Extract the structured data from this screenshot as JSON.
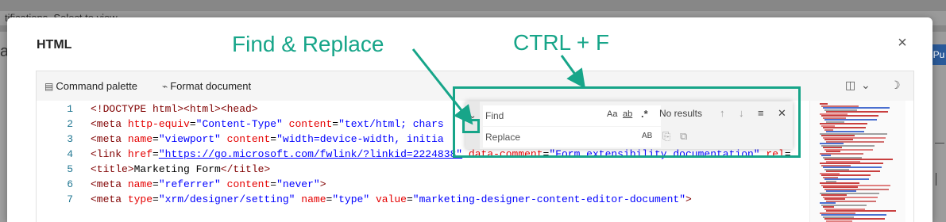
{
  "background": {
    "notification_strip": "tifications. Select to view",
    "left_fragment": "ap",
    "right_chip": "Pu"
  },
  "modal": {
    "title": "HTML",
    "close_icon": "×"
  },
  "toolbar": {
    "command_palette_label": "Command palette",
    "format_document_label": "Format document",
    "command_palette_icon": "▤",
    "format_document_icon": "⌁",
    "split_icon": "◫",
    "chevron_icon": "⌄",
    "theme_icon": "☽"
  },
  "editor": {
    "lines": [
      {
        "n": "1",
        "parts": [
          [
            "t-tag",
            "<!DOCTYPE html><html><head>"
          ]
        ]
      },
      {
        "n": "2",
        "parts": [
          [
            "t-tag",
            "    <meta "
          ],
          [
            "t-attr",
            "http-equiv"
          ],
          [
            "t-txt",
            "="
          ],
          [
            "t-val",
            "\"Content-Type\""
          ],
          [
            "t-txt",
            " "
          ],
          [
            "t-attr",
            "content"
          ],
          [
            "t-txt",
            "="
          ],
          [
            "t-val",
            "\"text/html; chars"
          ]
        ]
      },
      {
        "n": "3",
        "parts": [
          [
            "t-tag",
            "    <meta "
          ],
          [
            "t-attr",
            "name"
          ],
          [
            "t-txt",
            "="
          ],
          [
            "t-val",
            "\"viewport\""
          ],
          [
            "t-txt",
            " "
          ],
          [
            "t-attr",
            "content"
          ],
          [
            "t-txt",
            "="
          ],
          [
            "t-val",
            "\"width=device-width, initia"
          ]
        ]
      },
      {
        "n": "4",
        "parts": [
          [
            "t-tag",
            "    <link "
          ],
          [
            "t-attr",
            "href"
          ],
          [
            "t-txt",
            "="
          ],
          [
            "t-link",
            "\"https://go.microsoft.com/fwlink/?linkid=2224838\""
          ],
          [
            "t-txt",
            " "
          ],
          [
            "t-attr",
            "data-comment"
          ],
          [
            "t-txt",
            "="
          ],
          [
            "t-val",
            "\"Form extensibility documentation\""
          ],
          [
            "t-txt",
            " "
          ],
          [
            "t-attr",
            "rel"
          ],
          [
            "t-txt",
            "="
          ]
        ]
      },
      {
        "n": "5",
        "parts": [
          [
            "t-tag",
            "    <title>"
          ],
          [
            "t-txt",
            "Marketing Form"
          ],
          [
            "t-tag",
            "</title>"
          ]
        ]
      },
      {
        "n": "6",
        "parts": [
          [
            "t-tag",
            "    <meta "
          ],
          [
            "t-attr",
            "name"
          ],
          [
            "t-txt",
            "="
          ],
          [
            "t-val",
            "\"referrer\""
          ],
          [
            "t-txt",
            " "
          ],
          [
            "t-attr",
            "content"
          ],
          [
            "t-txt",
            "="
          ],
          [
            "t-val",
            "\"never\""
          ],
          [
            "t-tag",
            ">"
          ]
        ]
      },
      {
        "n": "7",
        "parts": [
          [
            "t-tag",
            "    <meta "
          ],
          [
            "t-attr",
            "type"
          ],
          [
            "t-txt",
            "="
          ],
          [
            "t-val",
            "\"xrm/designer/setting\""
          ],
          [
            "t-txt",
            " "
          ],
          [
            "t-attr",
            "name"
          ],
          [
            "t-txt",
            "="
          ],
          [
            "t-val",
            "\"type\""
          ],
          [
            "t-txt",
            " "
          ],
          [
            "t-attr",
            "value"
          ],
          [
            "t-txt",
            "="
          ],
          [
            "t-val",
            "\"marketing-designer-content-editor-document\""
          ],
          [
            "t-tag",
            ">"
          ]
        ]
      }
    ]
  },
  "find_widget": {
    "find_placeholder": "Find",
    "replace_placeholder": "Replace",
    "match_case": "Aa",
    "whole_word": "ab",
    "regex": ".*",
    "status": "No results",
    "prev_icon": "↑",
    "next_icon": "↓",
    "selection_icon": "≡",
    "close_icon": "✕",
    "preserve_case": "AB",
    "replace_icon": "⎘",
    "replace_all_icon": "⧉",
    "toggle_icon": "⌄"
  },
  "annotations": {
    "find_replace_label": "Find & Replace",
    "ctrl_f_label": "CTRL + F",
    "color": "#17a589"
  }
}
